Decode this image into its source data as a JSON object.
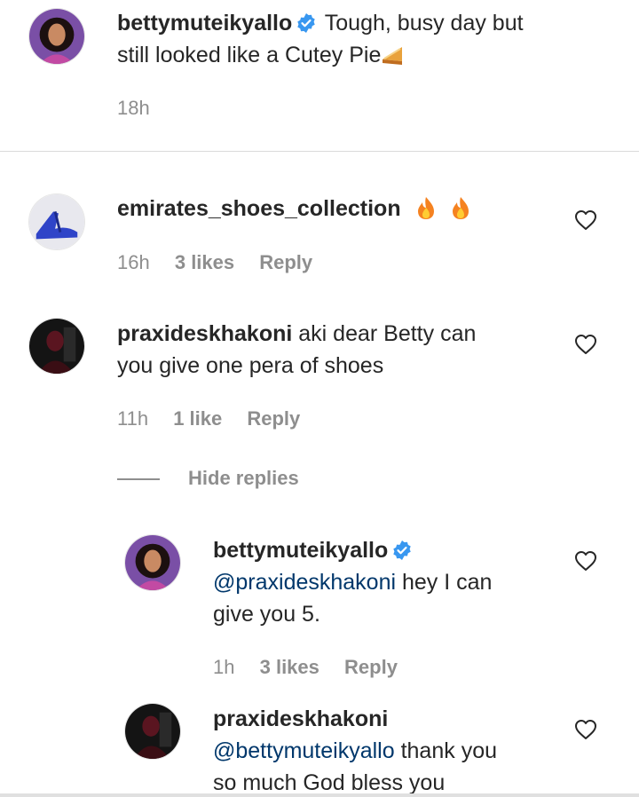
{
  "caption": {
    "username": "bettymuteikyallo",
    "verified": true,
    "text_line1": "Tough, busy day but",
    "text_line2": "still looked like a Cutey Pie",
    "emoji": "pie-emoji",
    "time": "18h"
  },
  "comments": [
    {
      "username": "emirates_shoes_collection",
      "text": "",
      "emoji": "fire-emoji x2",
      "time": "16h",
      "likes": "3 likes",
      "reply_label": "Reply"
    },
    {
      "username": "praxideskhakoni",
      "text_line1": "aki dear Betty can",
      "text_line2": "you give one pera of shoes",
      "time": "11h",
      "likes": "1 like",
      "reply_label": "Reply",
      "hide_replies_label": "Hide replies",
      "replies": [
        {
          "username": "bettymuteikyallo",
          "verified": true,
          "mention": "@praxideskhakoni",
          "text_line1": " hey I can",
          "text_line2": "give you 5.",
          "time": "1h",
          "likes": "3 likes",
          "reply_label": "Reply"
        },
        {
          "username": "praxideskhakoni",
          "mention": "@bettymuteikyallo",
          "text_line1": " thank you",
          "text_line2": "so much God bless you"
        }
      ]
    }
  ],
  "colors": {
    "text": "#262626",
    "secondary": "#8e8e8e",
    "mention": "#00376b",
    "verified": "#3897f0",
    "divider": "#dbdbdb"
  }
}
